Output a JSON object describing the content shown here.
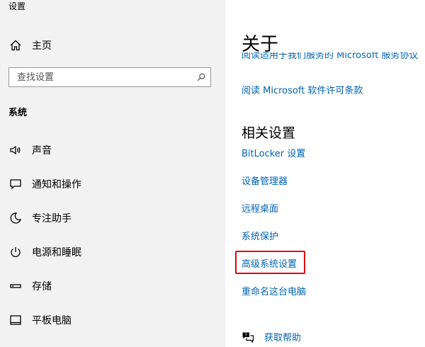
{
  "window": {
    "title": "设置"
  },
  "sidebar": {
    "home_label": "主页",
    "search_placeholder": "查找设置",
    "section_label": "系统",
    "items": [
      {
        "label": "声音",
        "icon": "speaker-icon"
      },
      {
        "label": "通知和操作",
        "icon": "message-icon"
      },
      {
        "label": "专注助手",
        "icon": "moon-icon"
      },
      {
        "label": "电源和睡眠",
        "icon": "power-icon"
      },
      {
        "label": "存储",
        "icon": "storage-icon"
      },
      {
        "label": "平板电脑",
        "icon": "tablet-icon"
      }
    ]
  },
  "main": {
    "title": "关于",
    "clipped_link": "阅读适用于我们服务的 Microsoft 服务协议",
    "license_link": "阅读 Microsoft 软件许可条款",
    "related_title": "相关设置",
    "related_links": [
      "BitLocker 设置",
      "设备管理器",
      "远程桌面",
      "系统保护",
      "高级系统设置",
      "重命名这台电脑"
    ],
    "help_label": "获取帮助"
  },
  "colors": {
    "link": "#0063b1",
    "highlight": "#e0000e",
    "sidebar_bg": "#f2f2f2"
  }
}
